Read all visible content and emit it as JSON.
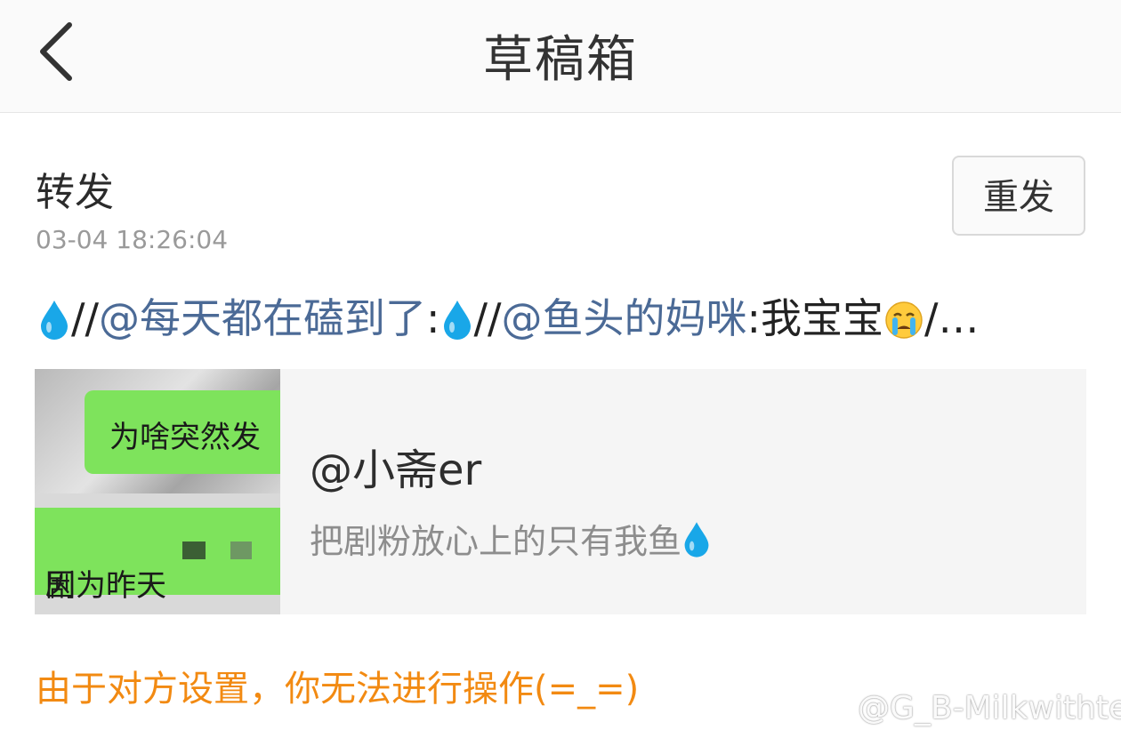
{
  "header": {
    "title": "草稿箱",
    "back_icon": "chevron-left-icon"
  },
  "draft": {
    "type_label": "转发",
    "timestamp": "03-04 18:26:04",
    "resend_label": "重发",
    "content": {
      "prefix_icon": "water-drop-icon",
      "sep1": "//",
      "mention1": "@每天都在磕到了",
      "colon1": ":",
      "drop2_icon": "water-drop-icon",
      "sep2": "//",
      "mention2": "@鱼头的妈咪",
      "colon2": ":",
      "text": "我宝宝",
      "emoji_icon": "crying-face-icon",
      "tail": "/…"
    },
    "card": {
      "thumb_line1": "为啥突然发",
      "thumb_line2_a": "因为昨天",
      "thumb_line2_b": "剧",
      "name": "@小斋er",
      "desc": "把剧粉放心上的只有我鱼",
      "desc_icon": "water-drop-icon"
    },
    "notice": "由于对方设置，你无法进行操作(=_=)"
  },
  "watermark": {
    "icon": "weibo-icon",
    "text": "@G_B-Milkwithtea"
  },
  "colors": {
    "mention": "#4b6a96",
    "notice": "#f28a12",
    "drop": "#19a7e8",
    "thumb_bubble": "#7ee35c"
  }
}
